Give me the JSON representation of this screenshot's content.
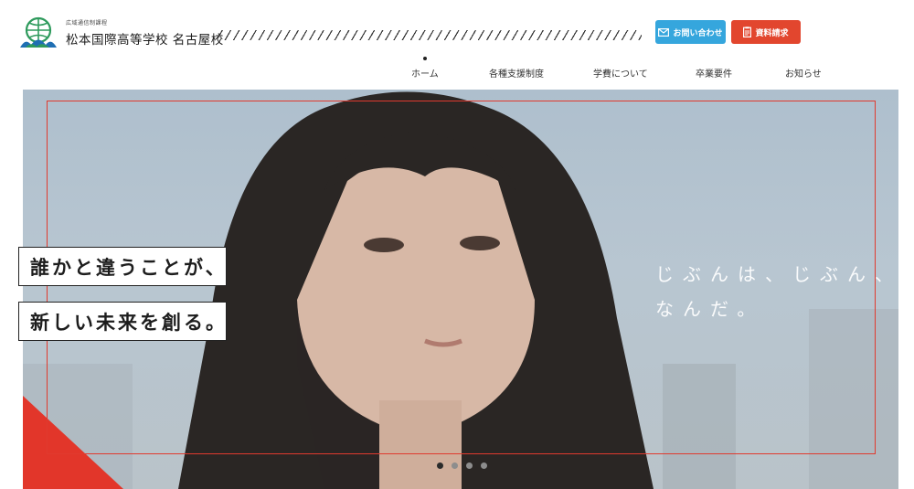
{
  "logo": {
    "subtitle": "広域通信制課程",
    "title": "松本国際高等学校 名古屋校"
  },
  "header_buttons": {
    "contact_label": "お問い合わせ",
    "request_label": "資料請求"
  },
  "nav": {
    "items": [
      {
        "label": "ホーム",
        "active": true
      },
      {
        "label": "各種支援制度"
      },
      {
        "label": "学費について"
      },
      {
        "label": "卒業要件"
      },
      {
        "label": "お知らせ"
      }
    ]
  },
  "hero": {
    "catch_line_1": "誰かと違うことが、",
    "catch_line_2": "新しい未来を創る。",
    "tagline_line_1": "じぶんは、じぶん、",
    "tagline_line_2": "なんだ。",
    "slide_count": 4,
    "active_slide": 1
  },
  "colors": {
    "contact_blue": "#35a6dd",
    "request_red": "#e2462e",
    "frame_red": "#e03a2e",
    "logo_green": "#2e9a5c"
  },
  "icons": {
    "contact": "mail-icon",
    "request": "document-icon"
  }
}
